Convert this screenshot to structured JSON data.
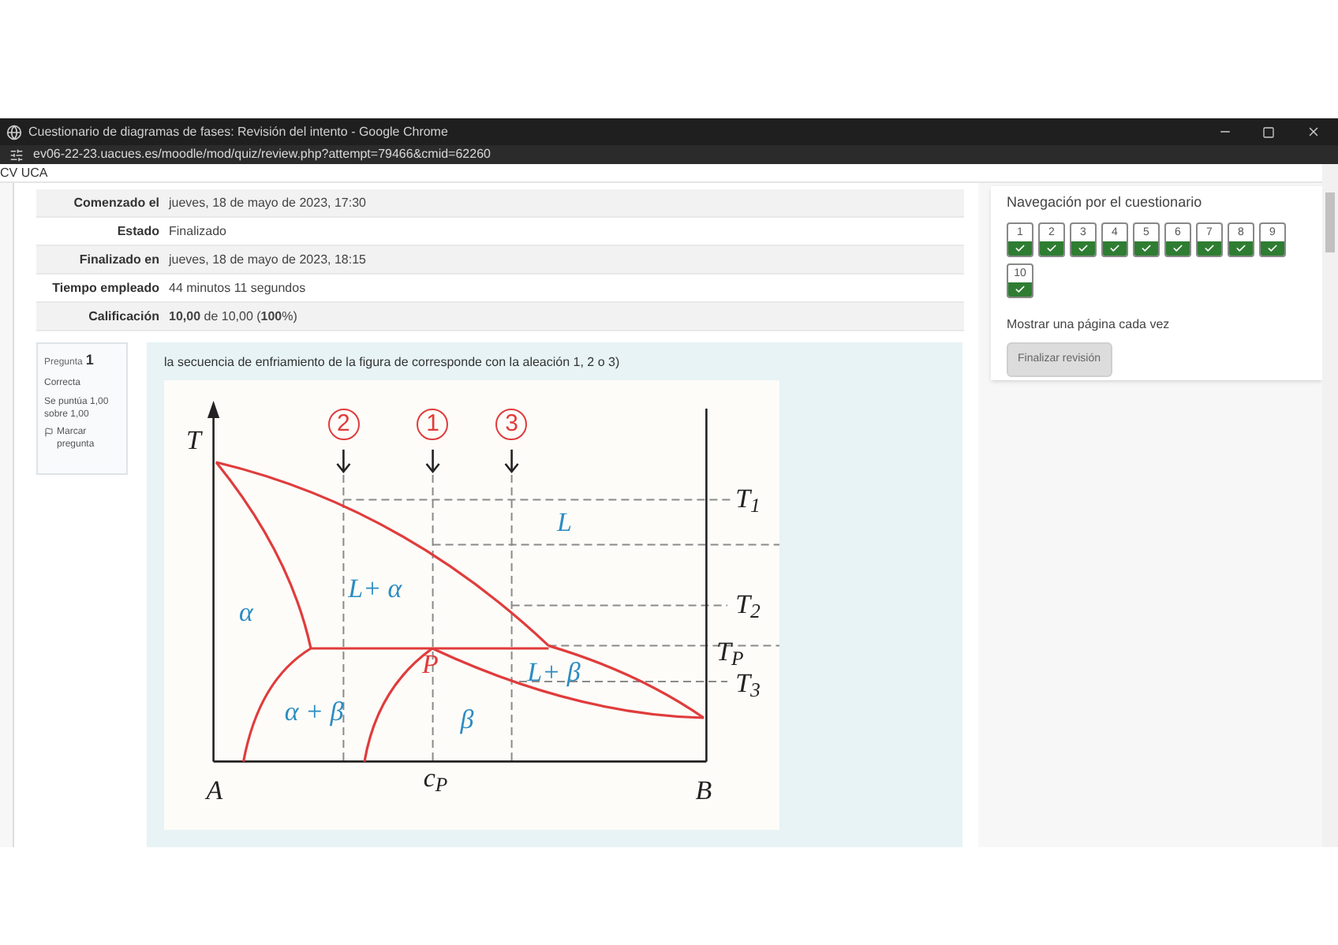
{
  "window": {
    "title": "Cuestionario de diagramas de fases: Revisión del intento - Google Chrome",
    "url": "ev06-22-23.uacues.es/moodle/mod/quiz/review.php?attempt=79466&cmid=62260",
    "site_label": "CV UCA"
  },
  "summary": [
    {
      "label": "Comenzado el",
      "value": "jueves, 18 de mayo de 2023, 17:30"
    },
    {
      "label": "Estado",
      "value": "Finalizado"
    },
    {
      "label": "Finalizado en",
      "value": "jueves, 18 de mayo de 2023, 18:15"
    },
    {
      "label": "Tiempo empleado",
      "value": "44 minutos 11 segundos"
    },
    {
      "label": "Calificación",
      "value": "**10,00** de 10,00 (**100**%)"
    }
  ],
  "question": {
    "label": "Pregunta",
    "number": "1",
    "status": "Correcta",
    "score": "Se puntúa 1,00 sobre 1,00",
    "flag": "Marcar pregunta",
    "text": "la secuencia de enfriamiento de la figura de corresponde con la aleación 1, 2 o 3)",
    "figure": {
      "markers": [
        "2",
        "1",
        "3"
      ],
      "labels": [
        {
          "text": "T",
          "kind": "axis"
        },
        {
          "text": "T$_{1}$",
          "kind": "axis"
        },
        {
          "text": "L",
          "kind": "phase"
        },
        {
          "text": "L+ α",
          "kind": "phase"
        },
        {
          "text": "T$_{2}$",
          "kind": "axis"
        },
        {
          "text": "α",
          "kind": "phase"
        },
        {
          "text": "T$_{P}$",
          "kind": "axis"
        },
        {
          "text": "P",
          "kind": "point"
        },
        {
          "text": "L+ β",
          "kind": "phase"
        },
        {
          "text": "T$_{3}$",
          "kind": "axis"
        },
        {
          "text": "α + β",
          "kind": "phase"
        },
        {
          "text": "β",
          "kind": "phase"
        },
        {
          "text": "c$_{P}$",
          "kind": "axis"
        },
        {
          "text": "A",
          "kind": "axis"
        },
        {
          "text": "B",
          "kind": "axis"
        }
      ]
    }
  },
  "nav": {
    "title": "Navegación por el cuestionario",
    "buttons": [
      {
        "label": "1",
        "answered": true
      },
      {
        "label": "2",
        "answered": true
      },
      {
        "label": "3",
        "answered": true
      },
      {
        "label": "4",
        "answered": true
      },
      {
        "label": "5",
        "answered": true
      },
      {
        "label": "6",
        "answered": true
      },
      {
        "label": "7",
        "answered": true
      },
      {
        "label": "8",
        "answered": true
      },
      {
        "label": "9",
        "answered": true
      },
      {
        "label": "10",
        "answered": true
      }
    ],
    "show_one": "Mostrar una página cada vez",
    "finish": "Finalizar revisión"
  }
}
